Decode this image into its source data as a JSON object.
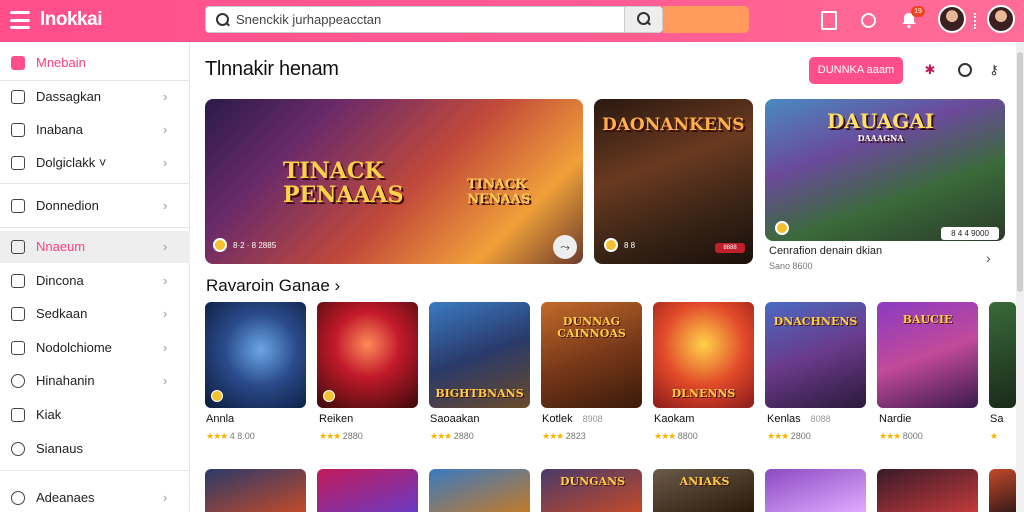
{
  "app": {
    "logo": "lnokkai"
  },
  "header": {
    "search_text": "Snenckik jurhappeacctan",
    "bell_badge": "19",
    "icons": [
      "menu-icon",
      "book-icon",
      "search-icon",
      "bell-icon",
      "avatar",
      "avatar"
    ]
  },
  "sidebar": {
    "items": [
      {
        "label": "Mnebain",
        "icon": "home-icon",
        "active_color": "#ff3e7e"
      },
      {
        "label": "Dassagkan",
        "icon": "square-icon"
      },
      {
        "label": "Inabana",
        "icon": "square-icon"
      },
      {
        "label": "Dolgiclakk ˅",
        "icon": "square-icon"
      },
      {
        "label": "Donnedion",
        "icon": "calendar-icon"
      },
      {
        "label": "Nnaeum",
        "icon": "grid-icon",
        "active": true
      },
      {
        "label": "Dincona",
        "icon": "list-icon"
      },
      {
        "label": "Sedkaan",
        "icon": "square-icon"
      },
      {
        "label": "Nodolchiome",
        "icon": "box-icon"
      },
      {
        "label": "Hinahanin",
        "icon": "clock-icon"
      },
      {
        "label": "Kiak",
        "icon": "lock-icon"
      },
      {
        "label": "Sianaus",
        "icon": "bulb-icon"
      },
      {
        "label": "Adeanaes",
        "icon": "help-icon"
      }
    ]
  },
  "main": {
    "title": "Tlnnakir henam",
    "pink_button": "DUNNKA aaam",
    "featured": [
      {
        "title_line1": "TINACK",
        "title_line2": "PENAAAS",
        "title2_line1": "TINACK",
        "title2_line2": "NENAAS",
        "meta": "8·2 · 8 2885"
      },
      {
        "title": "DAONANKENS",
        "meta": "8 8",
        "tag": "8888"
      },
      {
        "title": "DAUAGAI",
        "subtitle": "DAAAGNA",
        "tag": "8 4 4 9000",
        "caption": "Cenrafion denain dkian",
        "subcaption": "Sano 8600"
      }
    ],
    "section_title": "Ravaroin Ganae ›",
    "games": [
      {
        "name": "Annla",
        "rating": "4 8.00",
        "art": ""
      },
      {
        "name": "Reiken",
        "rating": "2880",
        "art": ""
      },
      {
        "name": "Saoaakan",
        "rating": "2880",
        "art": "BIGHTBNANS"
      },
      {
        "name": "Kotlek",
        "aux": "8908",
        "rating": "2823",
        "art": "DUNNAG CAINNOAS"
      },
      {
        "name": "Kaokam",
        "rating": "8800",
        "art": "DLNENNS"
      },
      {
        "name": "Kenlas",
        "aux": "8088",
        "rating": "2800",
        "art": "DNACHNENS"
      },
      {
        "name": "Nardie",
        "rating": "8000",
        "art": "BAUCIE"
      },
      {
        "name": "Sa",
        "rating": "8",
        "art": ""
      }
    ],
    "row2_art": [
      "",
      "",
      "",
      "DUNGANS",
      "ANIAKS",
      "",
      "",
      ""
    ]
  },
  "colors": {
    "brand": "#ff4f8b",
    "accent": "#ff9b5c",
    "star": "#f4b400"
  }
}
